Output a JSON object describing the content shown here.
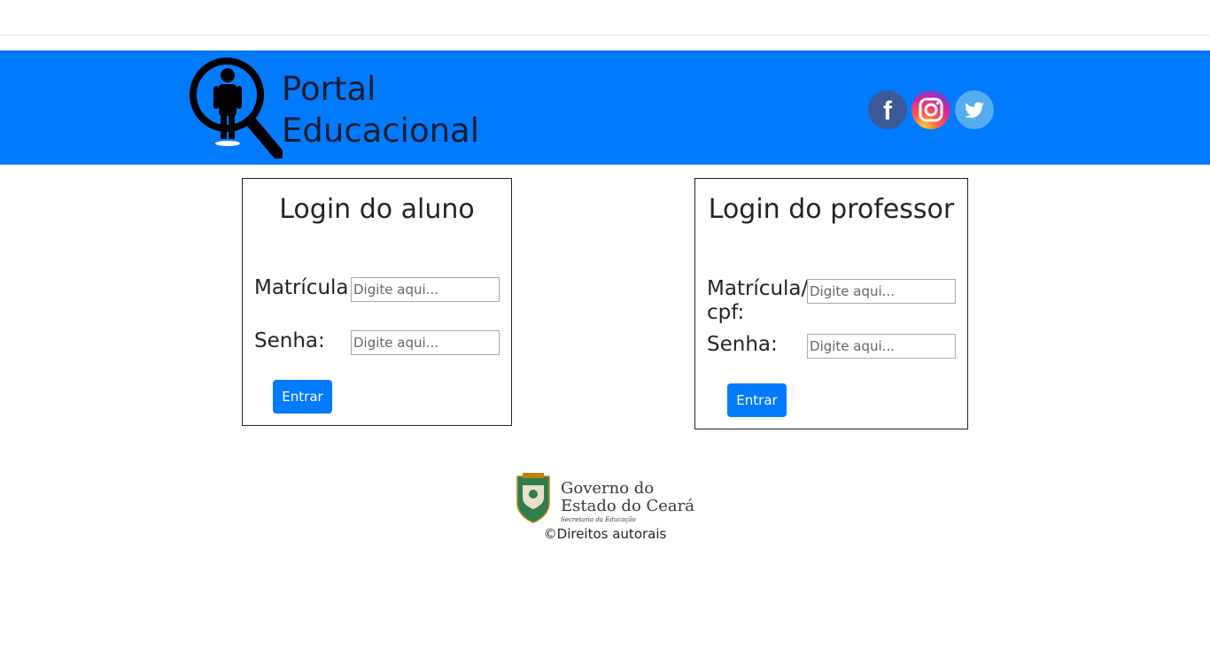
{
  "colors": {
    "header_bg": "#007bff",
    "button_bg": "#007bff",
    "button_text": "#ffffff",
    "facebook": "#3b5998",
    "twitter": "#55acee",
    "instagram_a": "#fdd835",
    "instagram_b": "#e1306c",
    "instagram_c": "#833ab4",
    "logo_green": "#2e7d4f"
  },
  "header": {
    "brand_line1": "Portal",
    "brand_line2": "Educacional",
    "logo_icon": "person-magnifier-icon",
    "social": [
      {
        "name": "facebook",
        "glyph": "f"
      },
      {
        "name": "instagram",
        "glyph": ""
      },
      {
        "name": "twitter",
        "glyph": ""
      }
    ]
  },
  "student_login": {
    "title": "Login do aluno",
    "matricula_label": "Matrícula:",
    "matricula_placeholder": "Digite aqui...",
    "senha_label": "Senha:",
    "senha_placeholder": "Digite aqui...",
    "submit_label": "Entrar"
  },
  "teacher_login": {
    "title": "Login do professor",
    "matricula_label_line1": "Matrícula/",
    "matricula_label_line2": "cpf:",
    "matricula_placeholder": "Digite aqui...",
    "senha_label": "Senha:",
    "senha_placeholder": "Digite aqui...",
    "submit_label": "Entrar"
  },
  "footer": {
    "gov_line1": "Governo do",
    "gov_line2": "Estado do Ceará",
    "gov_line3": "Secretaria da Educação",
    "copyright": "©Direitos autorais"
  }
}
